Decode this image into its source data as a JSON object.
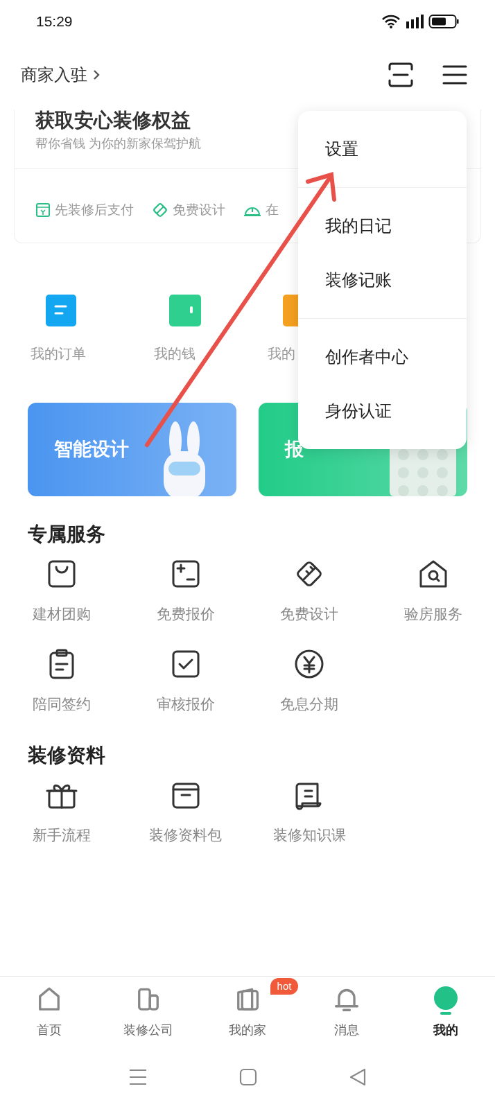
{
  "status_bar": {
    "time": "15:29"
  },
  "header": {
    "merchant_link": "商家入驻"
  },
  "promo_card": {
    "title": "获取安心装修权益",
    "subtitle": "帮你省钱 为你的新家保驾护航",
    "features": [
      "先装修后支付",
      "免费设计",
      "在"
    ]
  },
  "quick_links": [
    {
      "label": "我的订单",
      "color": "#12a7f0"
    },
    {
      "label": "我的钱",
      "color": "#2fd08f"
    },
    {
      "label": "我的",
      "color": "#f5a020"
    }
  ],
  "banners": [
    {
      "label": "智能设计",
      "color": "#4a95f0"
    },
    {
      "label": "报",
      "color": "#22cc88"
    }
  ],
  "sections": [
    {
      "title": "专属服务",
      "items": [
        "建材团购",
        "免费报价",
        "免费设计",
        "验房服务",
        "陪同签约",
        "审核报价",
        "免息分期"
      ]
    },
    {
      "title": "装修资料",
      "items": [
        "新手流程",
        "装修资料包",
        "装修知识课"
      ]
    }
  ],
  "menu": {
    "groups": [
      [
        "设置"
      ],
      [
        "我的日记",
        "装修记账"
      ],
      [
        "创作者中心",
        "身份认证"
      ]
    ]
  },
  "tab_bar": [
    {
      "label": "首页",
      "selected": false
    },
    {
      "label": "装修公司",
      "selected": false
    },
    {
      "label": "我的家",
      "selected": false,
      "badge": "hot"
    },
    {
      "label": "消息",
      "selected": false
    },
    {
      "label": "我的",
      "selected": true
    }
  ]
}
